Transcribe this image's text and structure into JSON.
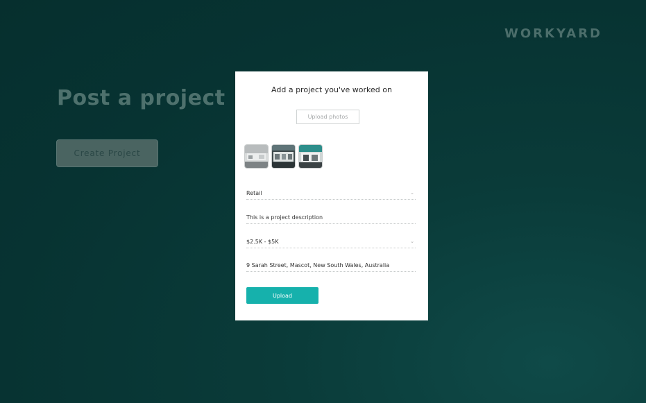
{
  "brand": {
    "name": "WORKYARD"
  },
  "background": {
    "headline": "Post a project",
    "create_button_label": "Create Project"
  },
  "modal": {
    "title": "Add a project you've worked on",
    "upload_photos_label": "Upload photos",
    "photos": [
      {
        "icon": "photo-thumbnail-1"
      },
      {
        "icon": "photo-thumbnail-2"
      },
      {
        "icon": "photo-thumbnail-3"
      }
    ],
    "category": {
      "value": "Retail",
      "icon": "chevron-down-icon"
    },
    "description": {
      "value": "This is a project description"
    },
    "budget": {
      "value": "$2.5K - $5K",
      "icon": "chevron-down-icon"
    },
    "address": {
      "value": "9 Sarah Street, Mascot, New South Wales, Australia"
    },
    "submit_label": "Upload"
  },
  "colors": {
    "background": "#073332",
    "accent": "#16b1ac",
    "modal": "#ffffff"
  }
}
